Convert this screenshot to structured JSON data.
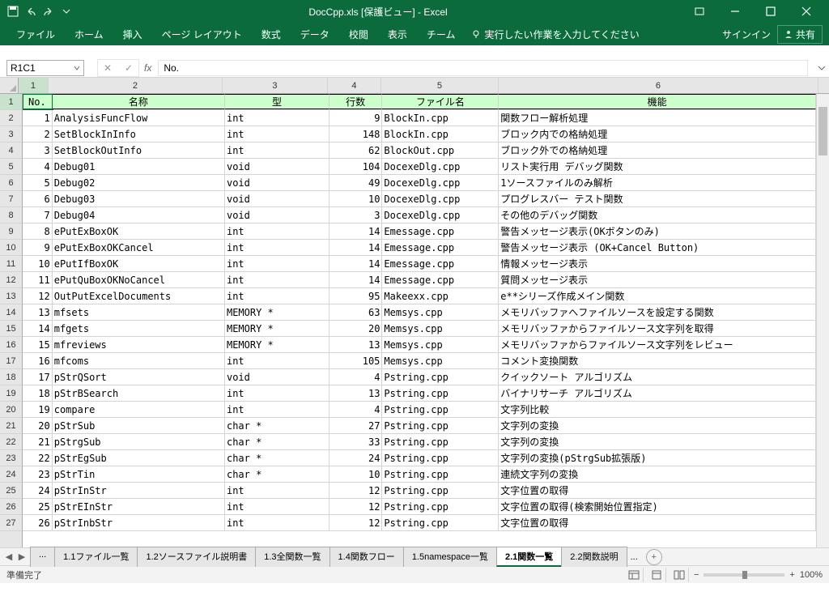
{
  "titlebar": {
    "title": "DocCpp.xls [保護ビュー] - Excel"
  },
  "ribbon": {
    "tabs": [
      "ファイル",
      "ホーム",
      "挿入",
      "ページ レイアウト",
      "数式",
      "データ",
      "校閲",
      "表示",
      "チーム"
    ],
    "tell_me": "実行したい作業を入力してください",
    "signin": "サインイン",
    "share": "共有"
  },
  "formula_bar": {
    "name_box": "R1C1",
    "formula": "No."
  },
  "columns": [
    "1",
    "2",
    "3",
    "4",
    "5",
    "6"
  ],
  "header_row": [
    "No.",
    "名称",
    "型",
    "行数",
    "ファイル名",
    "機能"
  ],
  "rows": [
    {
      "n": "1",
      "no": "1",
      "name": "AnalysisFuncFlow",
      "type": "int",
      "lines": "9",
      "file": "BlockIn.cpp",
      "func": "関数フロー解析処理"
    },
    {
      "n": "2",
      "no": "2",
      "name": "SetBlockInInfo",
      "type": "int",
      "lines": "148",
      "file": "BlockIn.cpp",
      "func": "ブロック内での格納処理"
    },
    {
      "n": "3",
      "no": "3",
      "name": "SetBlockOutInfo",
      "type": "int",
      "lines": "62",
      "file": "BlockOut.cpp",
      "func": "ブロック外での格納処理"
    },
    {
      "n": "4",
      "no": "4",
      "name": "Debug01",
      "type": "void",
      "lines": "104",
      "file": "DocexeDlg.cpp",
      "func": "リスト実行用 デバッグ関数"
    },
    {
      "n": "5",
      "no": "5",
      "name": "Debug02",
      "type": "void",
      "lines": "49",
      "file": "DocexeDlg.cpp",
      "func": "1ソースファイルのみ解析"
    },
    {
      "n": "6",
      "no": "6",
      "name": "Debug03",
      "type": "void",
      "lines": "10",
      "file": "DocexeDlg.cpp",
      "func": "プログレスバー テスト関数"
    },
    {
      "n": "7",
      "no": "7",
      "name": "Debug04",
      "type": "void",
      "lines": "3",
      "file": "DocexeDlg.cpp",
      "func": "その他のデバッグ関数"
    },
    {
      "n": "8",
      "no": "8",
      "name": "ePutExBoxOK",
      "type": "int",
      "lines": "14",
      "file": "Emessage.cpp",
      "func": "警告メッセージ表示(OKボタンのみ)"
    },
    {
      "n": "9",
      "no": "9",
      "name": "ePutExBoxOKCancel",
      "type": "int",
      "lines": "14",
      "file": "Emessage.cpp",
      "func": "警告メッセージ表示 (OK+Cancel Button)"
    },
    {
      "n": "10",
      "no": "10",
      "name": "ePutIfBoxOK",
      "type": "int",
      "lines": "14",
      "file": "Emessage.cpp",
      "func": "情報メッセージ表示"
    },
    {
      "n": "11",
      "no": "11",
      "name": "ePutQuBoxOKNoCancel",
      "type": "int",
      "lines": "14",
      "file": "Emessage.cpp",
      "func": "質問メッセージ表示"
    },
    {
      "n": "12",
      "no": "12",
      "name": "OutPutExcelDocuments",
      "type": "int",
      "lines": "95",
      "file": "Makeexx.cpp",
      "func": "e**シリーズ作成メイン関数"
    },
    {
      "n": "13",
      "no": "13",
      "name": "mfsets",
      "type": "MEMORY *",
      "lines": "63",
      "file": "Memsys.cpp",
      "func": "メモリバッファへファイルソースを設定する関数"
    },
    {
      "n": "14",
      "no": "14",
      "name": "mfgets",
      "type": "MEMORY *",
      "lines": "20",
      "file": "Memsys.cpp",
      "func": "メモリバッファからファイルソース文字列を取得"
    },
    {
      "n": "15",
      "no": "15",
      "name": "mfreviews",
      "type": "MEMORY *",
      "lines": "13",
      "file": "Memsys.cpp",
      "func": "メモリバッファからファイルソース文字列をレビュー"
    },
    {
      "n": "16",
      "no": "16",
      "name": "mfcoms",
      "type": "int",
      "lines": "105",
      "file": "Memsys.cpp",
      "func": "コメント変換関数"
    },
    {
      "n": "17",
      "no": "17",
      "name": "pStrQSort",
      "type": "void",
      "lines": "4",
      "file": "Pstring.cpp",
      "func": "クイックソート アルゴリズム"
    },
    {
      "n": "18",
      "no": "18",
      "name": "pStrBSearch",
      "type": "int",
      "lines": "13",
      "file": "Pstring.cpp",
      "func": "バイナリサーチ アルゴリズム"
    },
    {
      "n": "19",
      "no": "19",
      "name": "compare",
      "type": "int",
      "lines": "4",
      "file": "Pstring.cpp",
      "func": "文字列比較"
    },
    {
      "n": "20",
      "no": "20",
      "name": "pStrSub",
      "type": "char *",
      "lines": "27",
      "file": "Pstring.cpp",
      "func": "文字列の変換"
    },
    {
      "n": "21",
      "no": "21",
      "name": "pStrgSub",
      "type": "char *",
      "lines": "33",
      "file": "Pstring.cpp",
      "func": "文字列の変換"
    },
    {
      "n": "22",
      "no": "22",
      "name": "pStrEgSub",
      "type": "char *",
      "lines": "24",
      "file": "Pstring.cpp",
      "func": "文字列の変換(pStrgSub拡張版)"
    },
    {
      "n": "23",
      "no": "23",
      "name": "pStrTin",
      "type": "char *",
      "lines": "10",
      "file": "Pstring.cpp",
      "func": "連続文字列の変換"
    },
    {
      "n": "24",
      "no": "24",
      "name": "pStrInStr",
      "type": "int",
      "lines": "12",
      "file": "Pstring.cpp",
      "func": "文字位置の取得"
    },
    {
      "n": "25",
      "no": "25",
      "name": "pStrEInStr",
      "type": "int",
      "lines": "12",
      "file": "Pstring.cpp",
      "func": "文字位置の取得(検索開始位置指定)"
    },
    {
      "n": "26",
      "no": "26",
      "name": "pStrInbStr",
      "type": "int",
      "lines": "12",
      "file": "Pstring.cpp",
      "func": "文字位置の取得"
    }
  ],
  "sheet_tabs": {
    "tabs": [
      "...",
      "1.1ファイル一覧",
      "1.2ソースファイル説明書",
      "1.3全関数一覧",
      "1.4関数フロー",
      "1.5namespace一覧",
      "2.1関数一覧",
      "2.2関数説明"
    ],
    "active": "2.1関数一覧",
    "more": "..."
  },
  "statusbar": {
    "status": "準備完了",
    "zoom": "100%"
  }
}
